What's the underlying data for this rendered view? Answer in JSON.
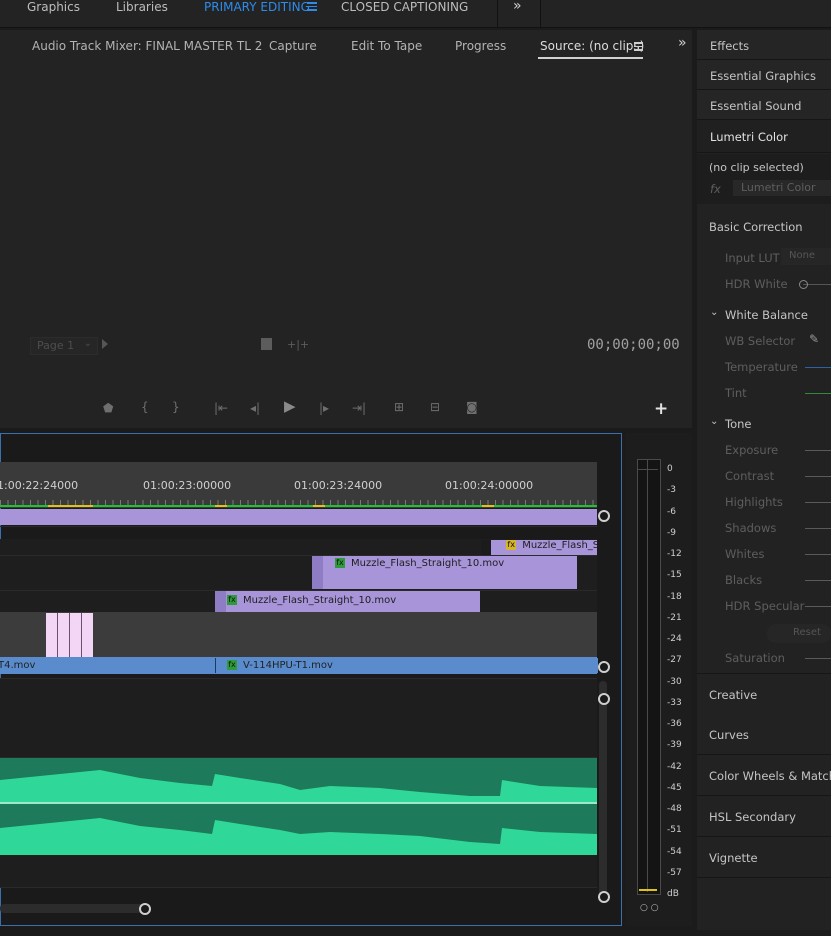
{
  "workspaces": {
    "items": [
      {
        "label": "Graphics"
      },
      {
        "label": "Libraries"
      },
      {
        "label": "PRIMARY EDITING"
      },
      {
        "label": "CLOSED CAPTIONING"
      }
    ],
    "overflow_icon": "double-chevron-right-icon",
    "menu_icon": "hamburger-icon"
  },
  "source_panel": {
    "tabs": [
      {
        "label": "Audio Track Mixer: FINAL MASTER TL 2"
      },
      {
        "label": "Capture"
      },
      {
        "label": "Edit To Tape"
      },
      {
        "label": "Progress"
      },
      {
        "label": "Source: (no clips)"
      }
    ],
    "page_dropdown": "Page 1",
    "timecode": "00;00;00;00",
    "transport_icons": [
      "marker-icon",
      "in-point-icon",
      "out-point-icon",
      "go-to-in-icon",
      "step-back-icon",
      "play-icon",
      "step-forward-icon",
      "go-to-out-icon",
      "insert-icon",
      "overwrite-icon",
      "export-frame-icon",
      "add-button-icon"
    ]
  },
  "right_panel": {
    "collapsed_panels": [
      {
        "label": "Effects"
      },
      {
        "label": "Essential Graphics"
      },
      {
        "label": "Essential Sound"
      },
      {
        "label": "Lumetri Color"
      }
    ],
    "lumetri": {
      "clip_status": "(no clip selected)",
      "fx_label": "fx",
      "effect_name": "Lumetri Color",
      "basic_correction": "Basic Correction",
      "input_lut_label": "Input LUT",
      "input_lut_value": "None",
      "hdr_white": "HDR White",
      "white_balance": "White Balance",
      "wb_selector": "WB Selector",
      "temperature": "Temperature",
      "tint": "Tint",
      "tone": "Tone",
      "exposure": "Exposure",
      "contrast": "Contrast",
      "highlights": "Highlights",
      "shadows": "Shadows",
      "whites": "Whites",
      "blacks": "Blacks",
      "hdr_specular": "HDR Specular",
      "reset": "Reset",
      "saturation": "Saturation",
      "sections": [
        {
          "label": "Creative"
        },
        {
          "label": "Curves"
        },
        {
          "label": "Color Wheels & Match"
        },
        {
          "label": "HSL Secondary"
        },
        {
          "label": "Vignette"
        }
      ]
    }
  },
  "timeline": {
    "ruler_labels": [
      "1:00:22:24000",
      "01:00:23:00000",
      "01:00:23:24000",
      "01:00:24:00000"
    ],
    "clips": [
      {
        "name": "Muzzle_Flash_Str",
        "fx": "fx"
      },
      {
        "name": "Muzzle_Flash_Straight_10.mov",
        "fx": "fx"
      },
      {
        "name": "Muzzle_Flash_Straight_10.mov",
        "fx": "fx"
      },
      {
        "name": "T4.mov"
      },
      {
        "name": "V-114HPU-T1.mov",
        "fx": "fx"
      }
    ]
  },
  "audio_meter": {
    "scale": [
      "0",
      "-3",
      "-6",
      "-9",
      "-12",
      "-15",
      "-18",
      "-21",
      "-24",
      "-27",
      "-30",
      "-33",
      "-36",
      "-39",
      "-42",
      "-45",
      "-48",
      "-51",
      "-54",
      "-57",
      "dB"
    ]
  },
  "colors": {
    "accent": "#2d8ceb",
    "clip_purple": "#a894d8",
    "clip_blue": "#5a8ccd",
    "audio_green": "#2fd898",
    "panel_bg": "#232323"
  }
}
